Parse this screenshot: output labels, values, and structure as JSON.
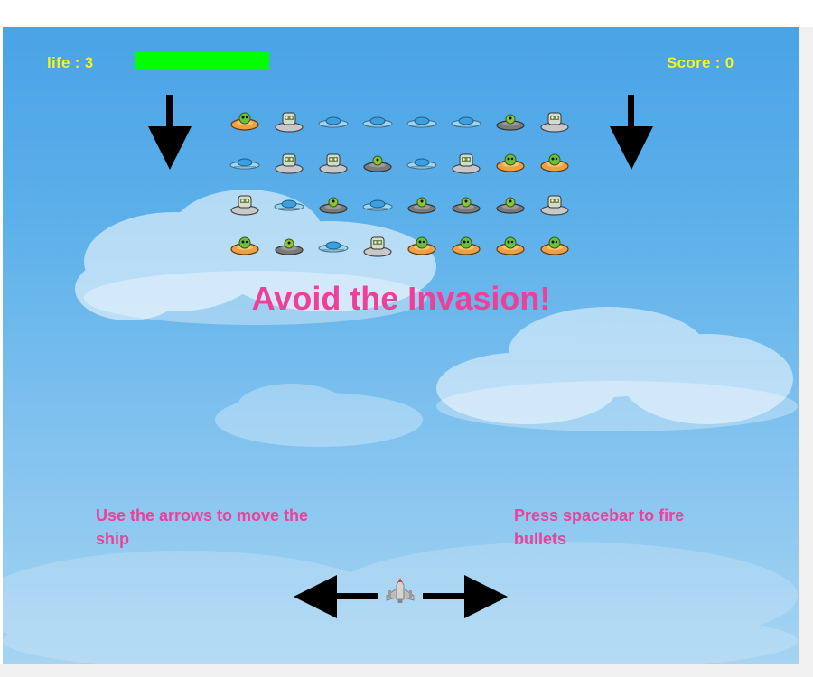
{
  "hud": {
    "life_label": "life : 3",
    "life_fraction": 1.0,
    "score_label": "Score : 0",
    "text_color": "#f4f42a",
    "life_bar_color": "#00ff00"
  },
  "title": "Avoid the Invasion!",
  "hints": {
    "move": "Use the arrows to move the ship",
    "fire": "Press spacebar to fire bullets"
  },
  "colors": {
    "accent_pink": "#ee3f99",
    "sky": "#5cb0ea"
  },
  "enemy_grid": {
    "rows": [
      [
        "orange-alien-saucer",
        "robot-saucer",
        "blue-saucer",
        "blue-saucer",
        "blue-saucer",
        "blue-saucer",
        "gray-saucer",
        "robot-saucer"
      ],
      [
        "blue-saucer",
        "robot-saucer",
        "robot-saucer",
        "gray-saucer",
        "blue-saucer",
        "robot-saucer",
        "orange-alien-saucer",
        "orange-alien-saucer"
      ],
      [
        "robot-saucer",
        "blue-saucer",
        "gray-saucer",
        "blue-saucer",
        "gray-saucer",
        "gray-saucer",
        "gray-saucer",
        "robot-saucer"
      ],
      [
        "orange-alien-saucer",
        "gray-saucer",
        "blue-saucer",
        "robot-saucer",
        "orange-alien-saucer",
        "orange-alien-saucer",
        "orange-alien-saucer",
        "orange-alien-saucer"
      ]
    ]
  },
  "icons": {
    "down_arrows": [
      "down-arrow-icon",
      "down-arrow-icon"
    ],
    "move_arrows": [
      "left-arrow-icon",
      "right-arrow-icon"
    ],
    "player": "spaceship-icon"
  }
}
